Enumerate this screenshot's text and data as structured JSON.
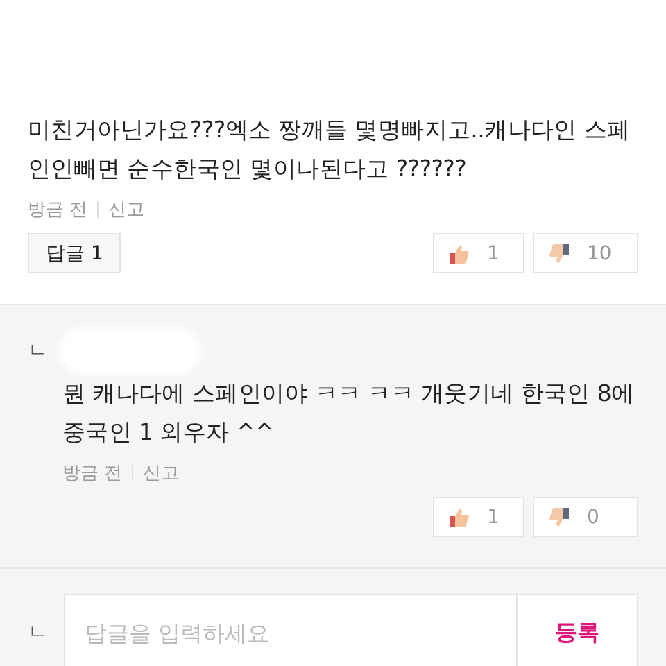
{
  "comment": {
    "text": "미친거아닌가요???엑소 짱깨들 몇명빠지고..캐나다인 스페인인빼면 순수한국인 몇이나된다고 ??????",
    "time": "방금 전",
    "report": "신고",
    "reply_button": "답글 1",
    "likes": "1",
    "dislikes": "10"
  },
  "replies": [
    {
      "marker": "ㄴ",
      "text": "뭔 캐나다에 스페인이야 ㅋㅋ ㅋㅋ 개웃기네 한국인 8에 중국인 1 외우자 ^^",
      "time": "방금 전",
      "report": "신고",
      "likes": "1",
      "dislikes": "0"
    }
  ],
  "reply_form": {
    "marker": "ㄴ",
    "placeholder": "답글을 입력하세요",
    "submit": "등록"
  }
}
